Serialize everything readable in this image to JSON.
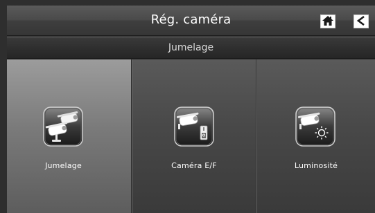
{
  "header": {
    "title": "Rég. caméra",
    "home_icon": "home-icon",
    "back_icon": "back-arrow-icon"
  },
  "subheader": {
    "title": "Jumelage"
  },
  "tiles": [
    {
      "label": "Jumelage",
      "icon": "camera-pairing-icon",
      "selected": true
    },
    {
      "label": "Caméra E/F",
      "icon": "camera-on-off-icon",
      "selected": false
    },
    {
      "label": "Luminosité",
      "icon": "camera-brightness-icon",
      "selected": false
    }
  ],
  "colors": {
    "background": "#2e2e2e",
    "selected_tile": "#8a8a8a",
    "tile": "#484848",
    "text": "#ffffff"
  }
}
